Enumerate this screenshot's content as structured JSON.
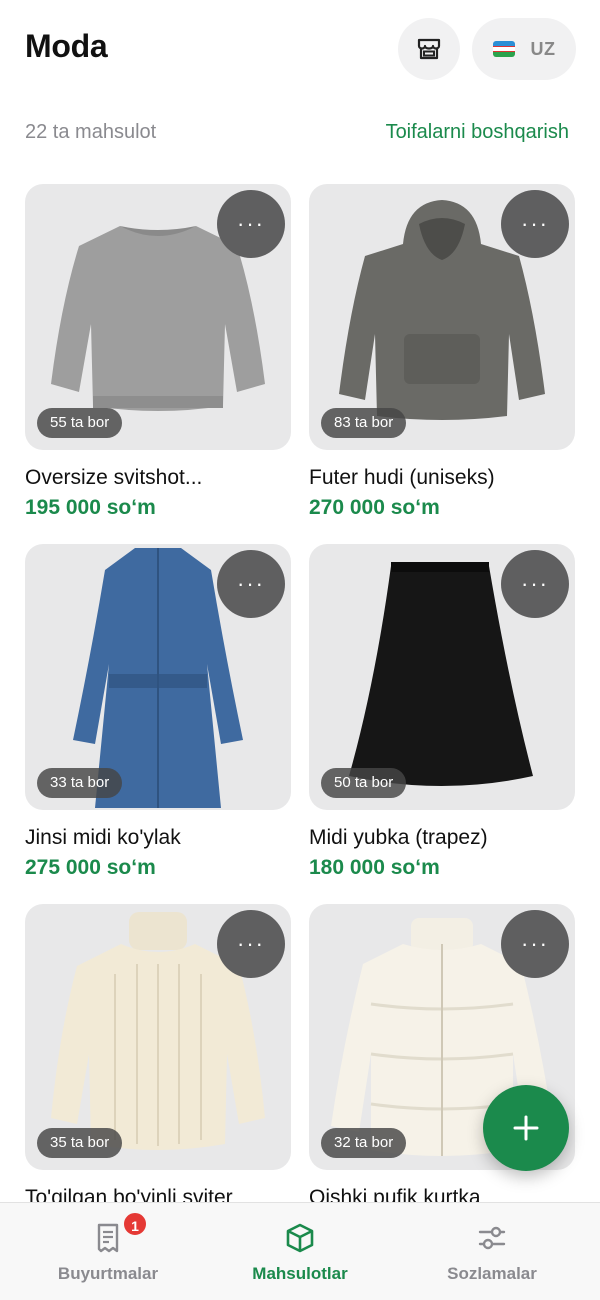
{
  "header": {
    "title": "Moda",
    "store_icon": "store-icon",
    "language": {
      "code": "UZ",
      "flag": "uzbekistan-flag-icon"
    }
  },
  "summary": {
    "count_text": "22 ta mahsulot",
    "manage_link": "Toifalarni boshqarish"
  },
  "products": [
    {
      "name": "Oversize svitshot...",
      "price": "195 000 so‘m",
      "stock": "55 ta bor",
      "image": "gray-sweatshirt"
    },
    {
      "name": "Futer hudi (uniseks)",
      "price": "270 000 so‘m",
      "stock": "83 ta bor",
      "image": "gray-hoodie"
    },
    {
      "name": "Jinsi midi ko'ylak",
      "price": "275 000 so‘m",
      "stock": "33 ta bor",
      "image": "denim-dress"
    },
    {
      "name": "Midi yubka (trapez)",
      "price": "180 000 so‘m",
      "stock": "50 ta bor",
      "image": "black-skirt"
    },
    {
      "name": "To'qilgan bo'yinli sviter",
      "price": "",
      "stock": "35 ta bor",
      "image": "cream-turtleneck"
    },
    {
      "name": "Qishki pufik kurtka",
      "price": "",
      "stock": "32 ta bor",
      "image": "cream-puffer-jacket"
    }
  ],
  "more_label": "···",
  "fab": {
    "icon": "plus-icon"
  },
  "nav": {
    "items": [
      {
        "label": "Buyurtmalar",
        "icon": "receipt-icon",
        "badge": "1"
      },
      {
        "label": "Mahsulotlar",
        "icon": "box-icon"
      },
      {
        "label": "Sozlamalar",
        "icon": "sliders-icon"
      }
    ],
    "active_index": 1
  },
  "colors": {
    "accent": "#1b8a4c",
    "badge": "#e53935",
    "muted": "#8a8a8f"
  }
}
